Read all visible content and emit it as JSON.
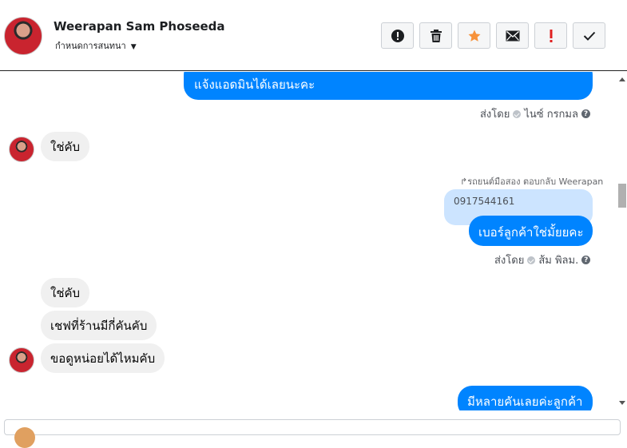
{
  "header": {
    "contact_name": "Weerapan Sam Phoseeda",
    "assign_label": "กำหนดการสนทนา",
    "actions": [
      {
        "name": "report-spam-icon",
        "label": "!"
      },
      {
        "name": "trash-icon",
        "label": ""
      },
      {
        "name": "star-icon",
        "label": ""
      },
      {
        "name": "mail-icon",
        "label": ""
      },
      {
        "name": "important-icon",
        "label": "!"
      },
      {
        "name": "check-icon",
        "label": ""
      }
    ]
  },
  "messages": {
    "m1_text": "แจ้งแอดมินได้เลยนะคะ",
    "m1_sent_prefix": "ส่งโดย",
    "m1_sender": "ไนซ์ กรกมล",
    "m2_text": "ใช่คับ",
    "reply_meta": "↱รถยนต์มือสอง ตอบกลับ Weerapan",
    "quoted_text": "0917544161",
    "m3_text": "เบอร์ลูกค้าใช่มั้ยยคะ",
    "m3_sent_prefix": "ส่งโดย",
    "m3_sender": "ส้ม พิลม.",
    "m4_text": "ใช่คับ",
    "m5_text": "เชฟที่ร้านมีกี่คันคับ",
    "m6_text": "ขอดูหน่อยได้ไหมคับ",
    "m7_text": "มีหลายคันเลยค่ะลูกค้า",
    "help_glyph": "?"
  },
  "colors": {
    "outgoing": "#0084ff",
    "incoming": "#f0f0f0",
    "quoted": "#cce4ff",
    "star": "#f7923b",
    "important": "#e02020"
  }
}
